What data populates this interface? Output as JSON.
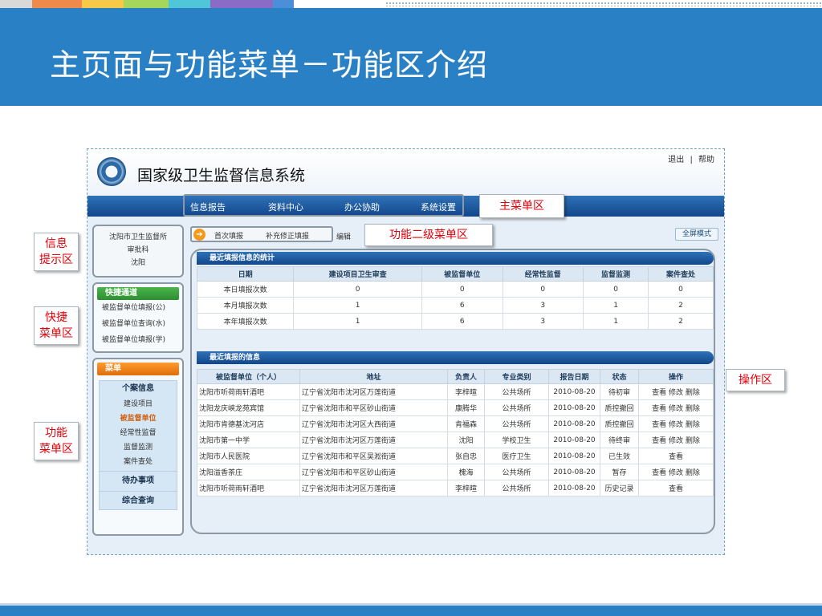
{
  "slide": {
    "title": "主页面与功能菜单－功能区介绍",
    "stripe_colors": [
      "#d9d9d9",
      "#f08a4b",
      "#f7c948",
      "#a6d65a",
      "#4fc7d8",
      "#8a6cc7",
      "#4b8fd8"
    ]
  },
  "app": {
    "system_title": "国家级卫生监督信息系统",
    "top_links": [
      "退出",
      "|",
      "帮助"
    ],
    "main_menu": [
      "信息报告",
      "资料中心",
      "办公协助",
      "系统设置"
    ],
    "info_box": [
      "沈阳市卫生监督所",
      "审批科",
      "沈阳"
    ],
    "quick_menu": {
      "title": "快捷通道",
      "items": [
        "被监督单位填报(公)",
        "被监督单位查询(水)",
        "被监督单位填报(学)"
      ]
    },
    "func_menu": {
      "title": "菜单",
      "group1": "个案信息",
      "items": [
        "建设项目",
        "被监督单位",
        "经常性监督",
        "监督监测",
        "案件查处"
      ],
      "group2": "待办事项",
      "group3": "综合查询"
    },
    "sub_menu": [
      "首次填报",
      "补充修正填报",
      "编辑"
    ],
    "fullscreen_label": "全屏模式",
    "stats": {
      "title": "最近填报信息的统计",
      "headers": [
        "日期",
        "建设项目卫生审查",
        "被监督单位",
        "经常性监督",
        "监督监测",
        "案件查处"
      ],
      "rows": [
        [
          "本日填报次数",
          "0",
          "0",
          "0",
          "0",
          "0"
        ],
        [
          "本月填报次数",
          "1",
          "6",
          "3",
          "1",
          "2"
        ],
        [
          "本年填报次数",
          "1",
          "6",
          "3",
          "1",
          "2"
        ]
      ]
    },
    "recent": {
      "title": "最近填报的信息",
      "headers": [
        "被监督单位（个人）",
        "地址",
        "负责人",
        "专业类别",
        "报告日期",
        "状态",
        "操作"
      ],
      "rows": [
        [
          "沈阳市听荷雨轩酒吧",
          "辽宁省沈阳市沈河区万莲街道",
          "李梓暄",
          "公共场所",
          "2010-08-20",
          "待初审",
          "查看 修改 删除"
        ],
        [
          "沈阳龙庆峡龙苑宾馆",
          "辽宁省沈阳市和平区砂山街道",
          "康腾华",
          "公共场所",
          "2010-08-20",
          "质控撤回",
          "查看 修改 删除"
        ],
        [
          "沈阳市肯德基沈河店",
          "辽宁省沈阳市沈河区大西街道",
          "肯福森",
          "公共场所",
          "2010-08-20",
          "质控撤回",
          "查看 修改 删除"
        ],
        [
          "沈阳市第一中学",
          "辽宁省沈阳市沈河区万莲街道",
          "沈阳",
          "学校卫生",
          "2010-08-20",
          "待终审",
          "查看 修改 删除"
        ],
        [
          "沈阳市人民医院",
          "辽宁省沈阳市和平区吴淞街道",
          "张自忠",
          "医疗卫生",
          "2010-08-20",
          "已生效",
          "查看"
        ],
        [
          "沈阳溢香茶庄",
          "辽宁省沈阳市和平区砂山街道",
          "槐海",
          "公共场所",
          "2010-08-20",
          "暂存",
          "查看 修改 删除"
        ],
        [
          "沈阳市听荷雨轩酒吧",
          "辽宁省沈阳市沈河区万莲街道",
          "李梓暄",
          "公共场所",
          "2010-08-20",
          "历史记录",
          "查看"
        ]
      ]
    }
  },
  "callouts": {
    "main_menu": "主菜单区",
    "sub_menu": "功能二级菜单区",
    "info": "信息\n提示区",
    "quick": "快捷\n菜单区",
    "func": "功能\n菜单区",
    "op": "操作区"
  }
}
